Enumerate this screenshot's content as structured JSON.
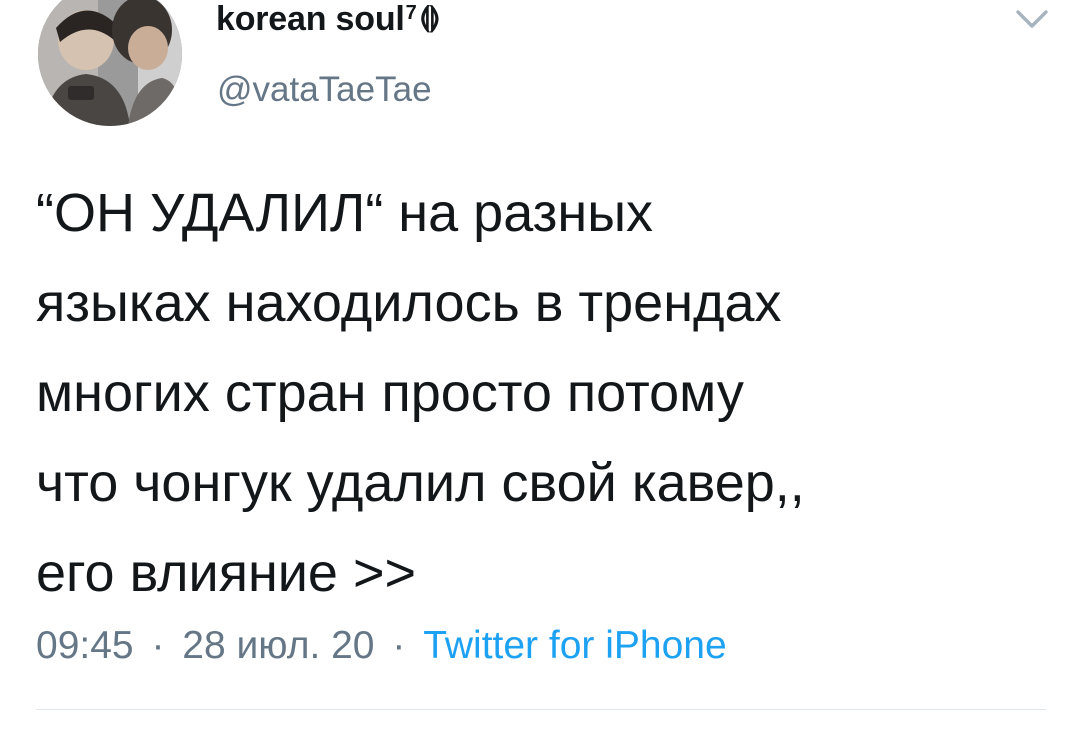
{
  "author": {
    "display_name": "korean soul",
    "name_superscript": "7",
    "name_emoji": "⟬⟭",
    "handle": "@vataTaeTae"
  },
  "tweet": {
    "lines": [
      "“ОН УДАЛИЛ“ на разных",
      "языках находилось в трендах",
      "многих стран просто потому",
      "что чонгук удалил свой кавер,,",
      "его влияние >>"
    ]
  },
  "meta": {
    "time": "09:45",
    "date": "28 июл. 20",
    "separator": "·",
    "source": "Twitter for iPhone"
  },
  "icons": {
    "menu": "chevron-down-icon",
    "avatar": "avatar"
  },
  "colors": {
    "text": "#14171a",
    "secondary": "#657786",
    "link": "#1da1f2",
    "divider": "#e1e8ed"
  }
}
